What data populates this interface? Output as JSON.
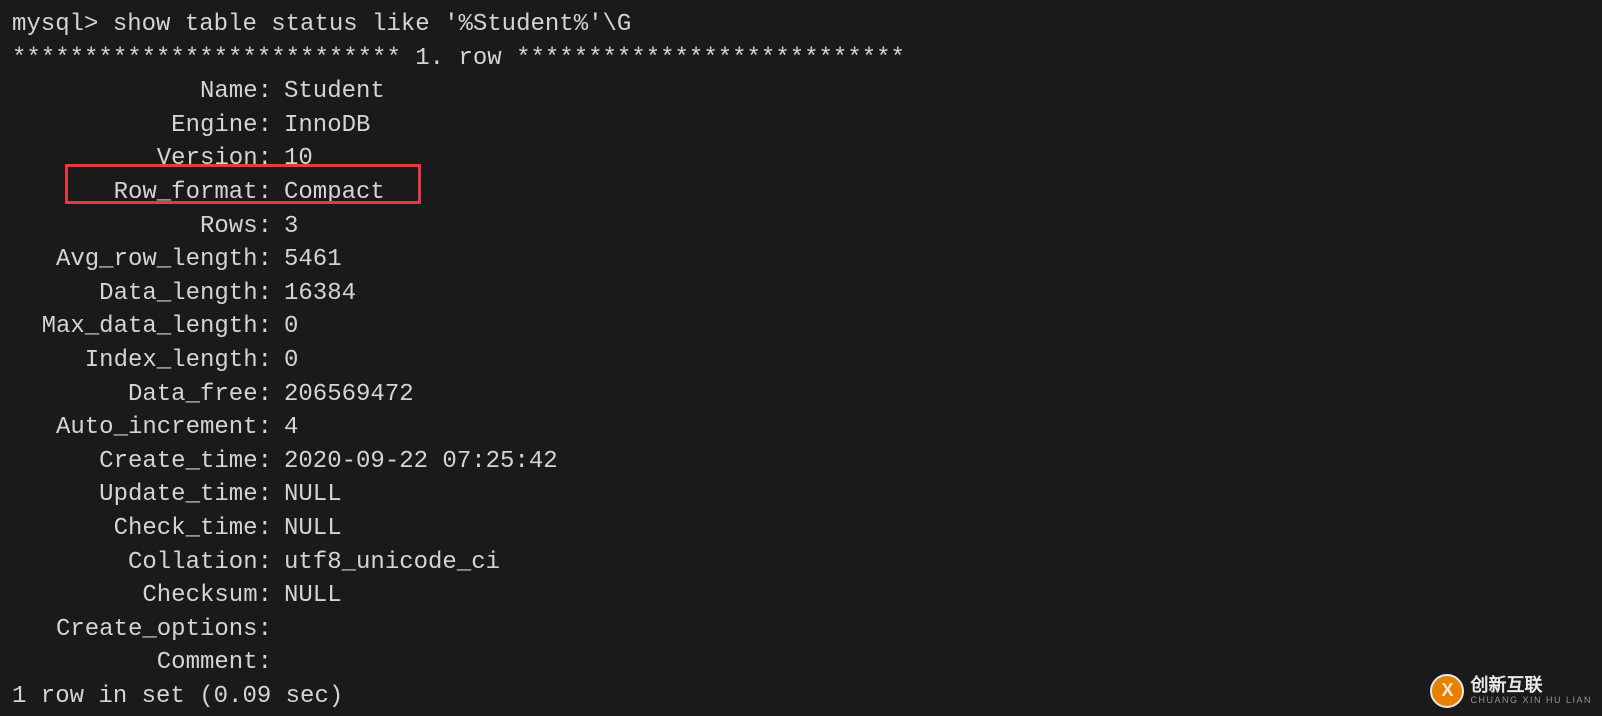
{
  "prompt": "mysql> show table status like '%Student%'\\G",
  "row_separator": "*************************** 1. row ***************************",
  "fields": [
    {
      "label": "Name",
      "value": "Student"
    },
    {
      "label": "Engine",
      "value": "InnoDB"
    },
    {
      "label": "Version",
      "value": "10"
    },
    {
      "label": "Row_format",
      "value": "Compact"
    },
    {
      "label": "Rows",
      "value": "3"
    },
    {
      "label": "Avg_row_length",
      "value": "5461"
    },
    {
      "label": "Data_length",
      "value": "16384"
    },
    {
      "label": "Max_data_length",
      "value": "0"
    },
    {
      "label": "Index_length",
      "value": "0"
    },
    {
      "label": "Data_free",
      "value": "206569472"
    },
    {
      "label": "Auto_increment",
      "value": "4"
    },
    {
      "label": "Create_time",
      "value": "2020-09-22 07:25:42"
    },
    {
      "label": "Update_time",
      "value": "NULL"
    },
    {
      "label": "Check_time",
      "value": "NULL"
    },
    {
      "label": "Collation",
      "value": "utf8_unicode_ci"
    },
    {
      "label": "Checksum",
      "value": "NULL"
    },
    {
      "label": "Create_options",
      "value": ""
    },
    {
      "label": "Comment",
      "value": ""
    }
  ],
  "footer": "1 row in set (0.09 sec)",
  "watermark": {
    "icon_letter": "X",
    "main": "创新互联",
    "sub": "CHUANG XIN HU LIAN"
  }
}
